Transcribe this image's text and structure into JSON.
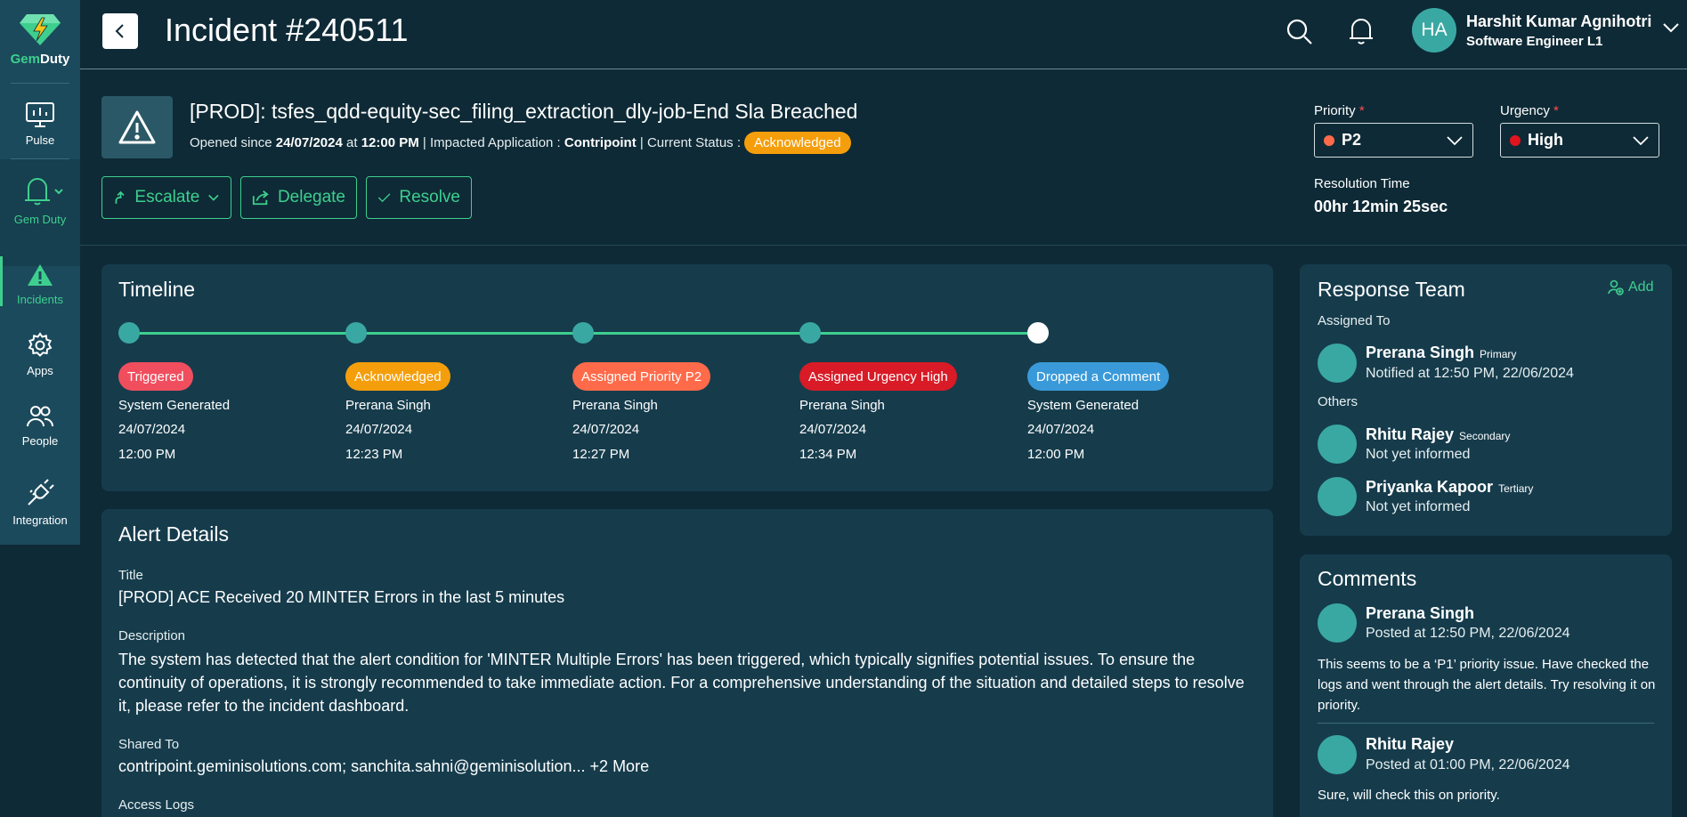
{
  "app": {
    "brand_part1": "Gem",
    "brand_part2": "Duty",
    "accent_color": "#3ecf8e"
  },
  "sidebar": {
    "items": [
      {
        "label": "Pulse",
        "icon": "pulse-chart-icon"
      },
      {
        "label": "Gem Duty",
        "icon": "bell-icon"
      },
      {
        "label": "Incidents",
        "icon": "warning-icon"
      },
      {
        "label": "Apps",
        "icon": "gear-icon"
      },
      {
        "label": "People",
        "icon": "people-icon"
      },
      {
        "label": "Integration",
        "icon": "plug-icon"
      }
    ]
  },
  "header": {
    "title": "Incident #240511",
    "user": {
      "initials": "HA",
      "name": "Harshit Kumar Agnihotri",
      "role": "Software Engineer L1"
    }
  },
  "incident": {
    "name": "[PROD]: tsfes_qdd-equity-sec_filing_extraction_dly-job-End Sla Breached",
    "meta_opened_prefix": "Opened since",
    "opened_date": "24/07/2024",
    "meta_at": "at",
    "opened_time": "12:00 PM",
    "meta_app_prefix": "| Impacted Application :",
    "application": "Contripoint",
    "meta_status_prefix": "| Current Status :",
    "status": "Acknowledged",
    "actions": {
      "escalate": "Escalate",
      "delegate": "Delegate",
      "resolve": "Resolve"
    },
    "priority": {
      "label": "Priority",
      "required_mark": "*",
      "value": "P2",
      "dot_color": "#ff6b4a"
    },
    "urgency": {
      "label": "Urgency",
      "required_mark": "*",
      "value": "High",
      "dot_color": "#e0141e"
    },
    "resolution": {
      "label": "Resolution Time",
      "value": "00hr 12min 25sec"
    }
  },
  "timeline": {
    "title": "Timeline",
    "events": [
      {
        "badge": "Triggered",
        "color": "#f04e5e",
        "actor": "System Generated",
        "date": "24/07/2024",
        "time": "12:00 PM"
      },
      {
        "badge": "Acknowledged",
        "color": "#f59e0b",
        "actor": "Prerana Singh",
        "date": "24/07/2024",
        "time": "12:23 PM"
      },
      {
        "badge": "Assigned Priority P2",
        "color": "#ff6b4a",
        "actor": "Prerana Singh",
        "date": "24/07/2024",
        "time": "12:27 PM"
      },
      {
        "badge": "Assigned Urgency High",
        "color": "#d81b26",
        "actor": "Prerana Singh",
        "date": "24/07/2024",
        "time": "12:34 PM"
      },
      {
        "badge": "Dropped a Comment",
        "color": "#3a9ad9",
        "actor": "System Generated",
        "date": "24/07/2024",
        "time": "12:00 PM"
      }
    ]
  },
  "alert_details": {
    "title": "Alert Details",
    "title_label": "Title",
    "title_value": "[PROD] ACE Received 20 MINTER Errors in the last 5 minutes",
    "description_label": "Description",
    "description_value": "The system has detected that the alert condition for 'MINTER Multiple Errors' has been triggered, which typically signifies potential issues. To ensure the continuity of operations, it is strongly recommended to take immediate action. For a comprehensive understanding of the situation and detailed steps to resolve it, please refer to the incident dashboard.",
    "shared_label": "Shared To",
    "shared_value": "contripoint.geminisolutions.com; sanchita.sahni@geminisolution... +2 More",
    "access_logs_label": "Access Logs"
  },
  "response_team": {
    "title": "Response Team",
    "add_label": "Add",
    "assigned_label": "Assigned To",
    "others_label": "Others",
    "members": [
      {
        "name": "Prerana Singh",
        "role": "Primary",
        "note": "Notified at 12:50 PM, 22/06/2024"
      },
      {
        "name": "Rhitu Rajey",
        "role": "Secondary",
        "note": "Not yet informed"
      },
      {
        "name": "Priyanka Kapoor",
        "role": "Tertiary",
        "note": "Not yet informed"
      }
    ]
  },
  "comments": {
    "title": "Comments",
    "items": [
      {
        "author": "Prerana Singh",
        "posted": "Posted at 12:50 PM, 22/06/2024",
        "text": "This seems to be a ‘P1’ priority issue. Have checked the logs and went through the alert details. Try resolving it on priority."
      },
      {
        "author": "Rhitu Rajey",
        "posted": "Posted at 01:00 PM, 22/06/2024",
        "text": "Sure, will check this on priority."
      }
    ]
  }
}
